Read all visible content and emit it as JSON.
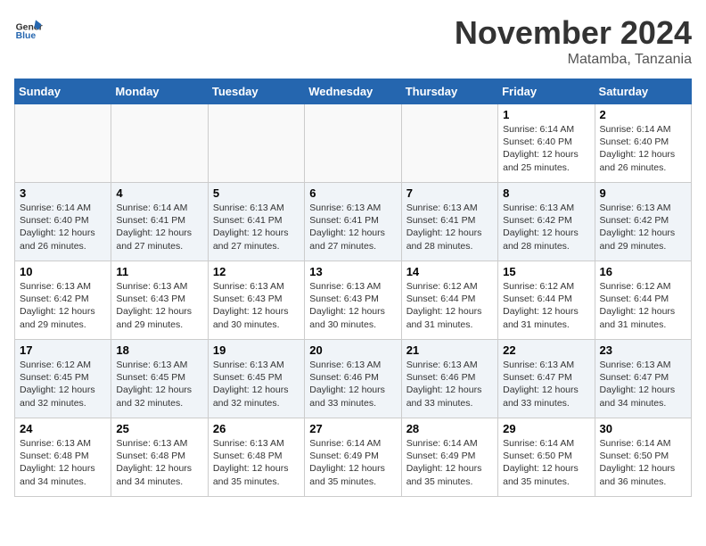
{
  "header": {
    "logo_general": "General",
    "logo_blue": "Blue",
    "month": "November 2024",
    "location": "Matamba, Tanzania"
  },
  "weekdays": [
    "Sunday",
    "Monday",
    "Tuesday",
    "Wednesday",
    "Thursday",
    "Friday",
    "Saturday"
  ],
  "weeks": [
    [
      {
        "day": "",
        "info": ""
      },
      {
        "day": "",
        "info": ""
      },
      {
        "day": "",
        "info": ""
      },
      {
        "day": "",
        "info": ""
      },
      {
        "day": "",
        "info": ""
      },
      {
        "day": "1",
        "info": "Sunrise: 6:14 AM\nSunset: 6:40 PM\nDaylight: 12 hours and 25 minutes."
      },
      {
        "day": "2",
        "info": "Sunrise: 6:14 AM\nSunset: 6:40 PM\nDaylight: 12 hours and 26 minutes."
      }
    ],
    [
      {
        "day": "3",
        "info": "Sunrise: 6:14 AM\nSunset: 6:40 PM\nDaylight: 12 hours and 26 minutes."
      },
      {
        "day": "4",
        "info": "Sunrise: 6:14 AM\nSunset: 6:41 PM\nDaylight: 12 hours and 27 minutes."
      },
      {
        "day": "5",
        "info": "Sunrise: 6:13 AM\nSunset: 6:41 PM\nDaylight: 12 hours and 27 minutes."
      },
      {
        "day": "6",
        "info": "Sunrise: 6:13 AM\nSunset: 6:41 PM\nDaylight: 12 hours and 27 minutes."
      },
      {
        "day": "7",
        "info": "Sunrise: 6:13 AM\nSunset: 6:41 PM\nDaylight: 12 hours and 28 minutes."
      },
      {
        "day": "8",
        "info": "Sunrise: 6:13 AM\nSunset: 6:42 PM\nDaylight: 12 hours and 28 minutes."
      },
      {
        "day": "9",
        "info": "Sunrise: 6:13 AM\nSunset: 6:42 PM\nDaylight: 12 hours and 29 minutes."
      }
    ],
    [
      {
        "day": "10",
        "info": "Sunrise: 6:13 AM\nSunset: 6:42 PM\nDaylight: 12 hours and 29 minutes."
      },
      {
        "day": "11",
        "info": "Sunrise: 6:13 AM\nSunset: 6:43 PM\nDaylight: 12 hours and 29 minutes."
      },
      {
        "day": "12",
        "info": "Sunrise: 6:13 AM\nSunset: 6:43 PM\nDaylight: 12 hours and 30 minutes."
      },
      {
        "day": "13",
        "info": "Sunrise: 6:13 AM\nSunset: 6:43 PM\nDaylight: 12 hours and 30 minutes."
      },
      {
        "day": "14",
        "info": "Sunrise: 6:12 AM\nSunset: 6:44 PM\nDaylight: 12 hours and 31 minutes."
      },
      {
        "day": "15",
        "info": "Sunrise: 6:12 AM\nSunset: 6:44 PM\nDaylight: 12 hours and 31 minutes."
      },
      {
        "day": "16",
        "info": "Sunrise: 6:12 AM\nSunset: 6:44 PM\nDaylight: 12 hours and 31 minutes."
      }
    ],
    [
      {
        "day": "17",
        "info": "Sunrise: 6:12 AM\nSunset: 6:45 PM\nDaylight: 12 hours and 32 minutes."
      },
      {
        "day": "18",
        "info": "Sunrise: 6:13 AM\nSunset: 6:45 PM\nDaylight: 12 hours and 32 minutes."
      },
      {
        "day": "19",
        "info": "Sunrise: 6:13 AM\nSunset: 6:45 PM\nDaylight: 12 hours and 32 minutes."
      },
      {
        "day": "20",
        "info": "Sunrise: 6:13 AM\nSunset: 6:46 PM\nDaylight: 12 hours and 33 minutes."
      },
      {
        "day": "21",
        "info": "Sunrise: 6:13 AM\nSunset: 6:46 PM\nDaylight: 12 hours and 33 minutes."
      },
      {
        "day": "22",
        "info": "Sunrise: 6:13 AM\nSunset: 6:47 PM\nDaylight: 12 hours and 33 minutes."
      },
      {
        "day": "23",
        "info": "Sunrise: 6:13 AM\nSunset: 6:47 PM\nDaylight: 12 hours and 34 minutes."
      }
    ],
    [
      {
        "day": "24",
        "info": "Sunrise: 6:13 AM\nSunset: 6:48 PM\nDaylight: 12 hours and 34 minutes."
      },
      {
        "day": "25",
        "info": "Sunrise: 6:13 AM\nSunset: 6:48 PM\nDaylight: 12 hours and 34 minutes."
      },
      {
        "day": "26",
        "info": "Sunrise: 6:13 AM\nSunset: 6:48 PM\nDaylight: 12 hours and 35 minutes."
      },
      {
        "day": "27",
        "info": "Sunrise: 6:14 AM\nSunset: 6:49 PM\nDaylight: 12 hours and 35 minutes."
      },
      {
        "day": "28",
        "info": "Sunrise: 6:14 AM\nSunset: 6:49 PM\nDaylight: 12 hours and 35 minutes."
      },
      {
        "day": "29",
        "info": "Sunrise: 6:14 AM\nSunset: 6:50 PM\nDaylight: 12 hours and 35 minutes."
      },
      {
        "day": "30",
        "info": "Sunrise: 6:14 AM\nSunset: 6:50 PM\nDaylight: 12 hours and 36 minutes."
      }
    ]
  ]
}
